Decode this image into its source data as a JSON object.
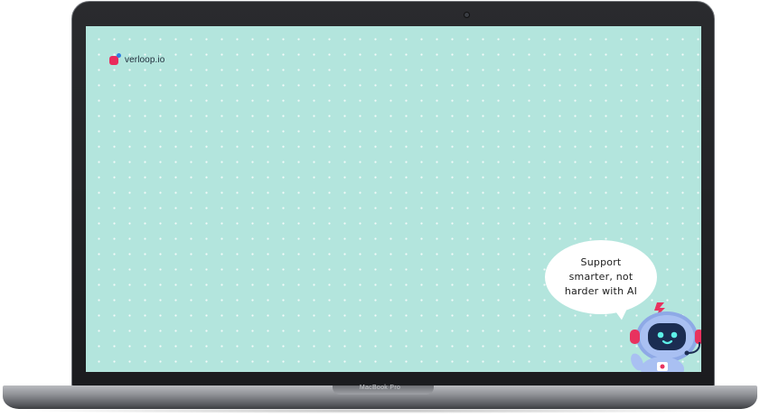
{
  "device": {
    "brand_label": "MacBook Pro"
  },
  "screen": {
    "background_color": "#b3e5dd",
    "logo": {
      "text": "verloop.io",
      "mark_colors": [
        "#ea2b5c",
        "#2f7de1"
      ]
    },
    "bubble": {
      "lines": [
        "Support",
        "smarter, not",
        "harder with AI"
      ]
    },
    "mascot": {
      "icon": "robot-mascot-icon"
    }
  }
}
